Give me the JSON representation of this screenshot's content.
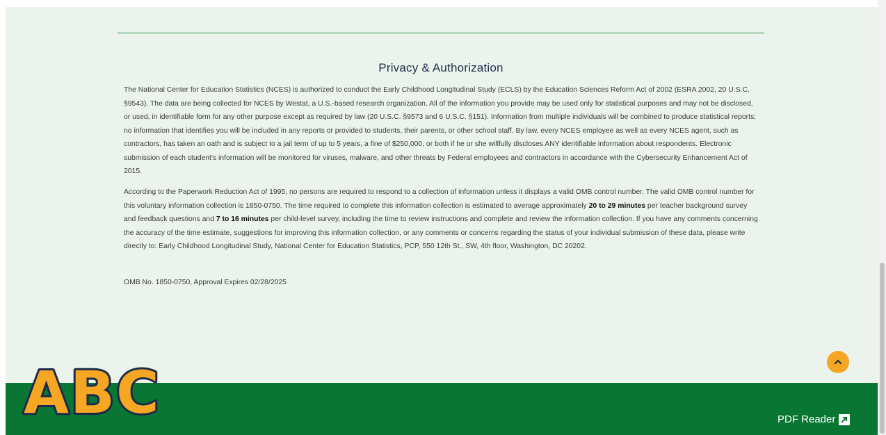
{
  "section": {
    "title": "Privacy & Authorization",
    "para1": [
      {
        "t": "The National Center for Education Statistics (NCES) is authorized to conduct the Early Childhood Longitudinal Study (ECLS) by the Education Sciences Reform Act of 2002 (ESRA 2002, 20 U.S.C. §9543). The data are being collected for NCES by Westat, a U.S.-based research organization. All of the information you provide may be used only for statistical purposes and may not be disclosed, or used, in identifiable form for any other purpose except as required by law (20 U.S.C. §9573 and 6 U.S.C. §151). Information from multiple individuals will be combined to produce statistical reports; no information that identifies you will be included in any reports or provided to students, their parents, or other school staff. By law, every NCES employee as well as every NCES agent, such as contractors, has taken an oath and is subject to a jail term of up to 5 years, a fine of $250,000, or both if he or she willfully discloses ANY identifiable information about respondents. Electronic submission of each student's information will be monitored for viruses, malware, and other threats by Federal employees and contractors in accordance with the Cybersecurity Enhancement Act of 2015.",
        "b": false
      }
    ],
    "para2": [
      {
        "t": "According to the Paperwork Reduction Act of 1995, no persons are required to respond to a collection of information unless it displays a valid OMB control number. The valid OMB control number for this voluntary information collection is 1850-0750. The time required to complete this information collection is estimated to average approximately ",
        "b": false
      },
      {
        "t": "20 to 29 minutes",
        "b": true
      },
      {
        "t": " per teacher background survey and feedback questions and ",
        "b": false
      },
      {
        "t": "7 to 16 minutes",
        "b": true
      },
      {
        "t": " per child-level survey, including the time to review instructions and complete and review the information collection. If you have any comments concerning the accuracy of the time estimate, suggestions for improving this information collection, or any comments or concerns regarding the status of your individual submission of these data, please write directly to: Early Childhood Longitudinal Study, National Center for Education Statistics, PCP, 550 12th St., SW, 4th floor, Washington, DC 20202.",
        "b": false
      }
    ],
    "omb": "OMB No. 1850-0750, Approval Expires 02/28/2025"
  },
  "footer": {
    "logo_text": "ABC",
    "pdf_reader_label": "PDF Reader",
    "pdf_icon": "external-link-icon"
  },
  "back_to_top": {
    "icon": "chevron-up-icon"
  },
  "colors": {
    "footer_green": "#097634",
    "content_bg": "#ebf3ec",
    "accent_orange": "#f5a623",
    "logo_fill": "#f5a623",
    "logo_outline": "#1b2a4a"
  }
}
